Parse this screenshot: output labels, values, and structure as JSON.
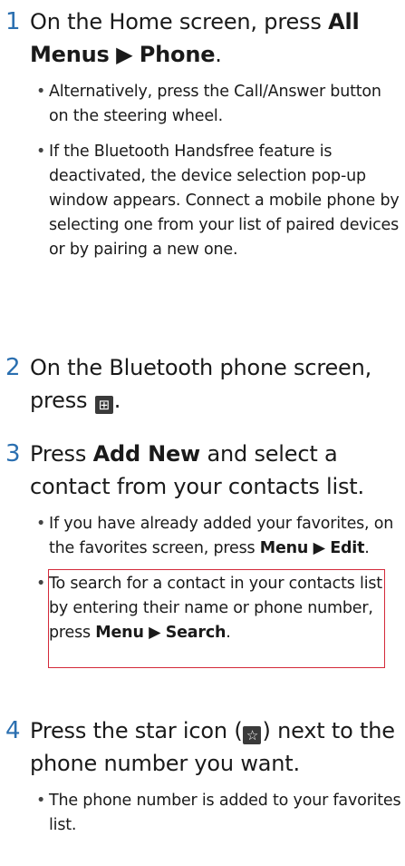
{
  "steps": [
    {
      "number": "1",
      "text_pre": "On the Home screen, press ",
      "bold1": "All Menus",
      "arrow": "▶",
      "bold2": "Phone",
      "text_post": ".",
      "bullets": [
        {
          "text": "Alternatively, press the Call/Answer button on the steering wheel."
        },
        {
          "text": "If the Bluetooth Handsfree feature is deactivated, the device selection pop-up window appears. Connect a mobile phone by selecting one from your list of paired devices or by pairing a new one."
        }
      ]
    },
    {
      "number": "2",
      "text_pre": "On the Bluetooth phone screen, press ",
      "icon": "⊞",
      "icon_name": "add-favorite-icon",
      "text_post": "."
    },
    {
      "number": "3",
      "text_pre": "Press ",
      "bold1": "Add New",
      "text_post": " and select a contact from your contacts list.",
      "bullets": [
        {
          "pre": "If you have already added your favorites, on the favorites screen, press ",
          "bold1": "Menu",
          "arrow": "▶",
          "bold2": "Edit",
          "post": "."
        },
        {
          "pre": "To search for a contact in your contacts list by entering their name or phone number, press ",
          "bold1": "Menu",
          "arrow": "▶",
          "bold2": "Search",
          "post": "."
        }
      ]
    },
    {
      "number": "4",
      "text_pre": "Press the star icon (",
      "icon": "☆",
      "icon_name": "star-icon",
      "text_post": ") next to the phone number you want.",
      "bullets": [
        {
          "text": "The phone number is added to your favorites list."
        }
      ]
    }
  ],
  "colors": {
    "step_number": "#2a6fb0",
    "highlight": "#d42a3a",
    "icon_bg": "#3a3a3a"
  }
}
